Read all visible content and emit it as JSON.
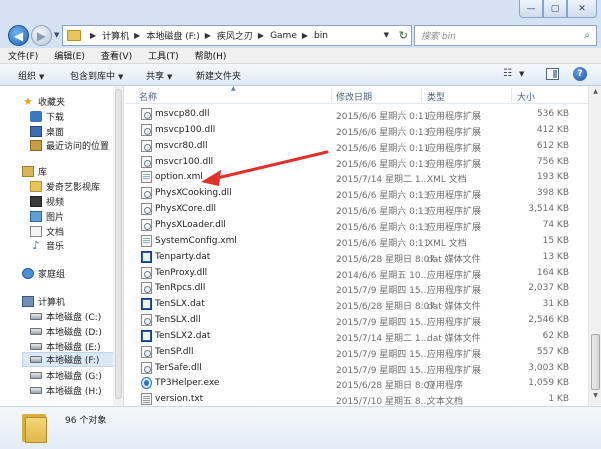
{
  "window": {
    "controls": [
      "—",
      "▢",
      "✕"
    ]
  },
  "nav": {
    "back_glyph": "◀",
    "forward_glyph": "▶",
    "dropdown_glyph": "▼"
  },
  "address": {
    "crumbs": [
      "计算机",
      "本地磁盘 (F:)",
      "疾风之刃",
      "Game",
      "bin"
    ],
    "separator": "▶",
    "dropdown_glyph": "▼",
    "refresh_glyph": "↻"
  },
  "search": {
    "placeholder": "搜索 bin",
    "icon": "search-icon"
  },
  "menu": [
    "文件(F)",
    "编辑(E)",
    "查看(V)",
    "工具(T)",
    "帮助(H)"
  ],
  "toolbar": {
    "organize": "组织",
    "include_in_library": "包含到库中",
    "share": "共享",
    "new_folder": "新建文件夹",
    "arrow": "▼",
    "view_glyph": "☷",
    "help_glyph": "?"
  },
  "sidebar": {
    "expander": "▲",
    "favorites": {
      "label": "收藏夹",
      "items": [
        "下载",
        "桌面",
        "最近访问的位置"
      ]
    },
    "library": {
      "label": "库",
      "items": [
        "爱奇艺影视库",
        "视频",
        "图片",
        "文档",
        "音乐"
      ]
    },
    "homegroup": {
      "label": "家庭组"
    },
    "computer": {
      "label": "计算机",
      "drives": [
        "本地磁盘 (C:)",
        "本地磁盘 (D:)",
        "本地磁盘 (E:)",
        "本地磁盘 (F:)",
        "本地磁盘 (G:)",
        "本地磁盘 (H:)"
      ],
      "selected_index": 3
    }
  },
  "columns": {
    "name": "名称",
    "modified": "修改日期",
    "type": "类型",
    "size": "大小",
    "sort_glyph": "▲"
  },
  "files": [
    {
      "name": "msvcp80.dll",
      "date": "2015/6/6 星期六 0:11",
      "type": "应用程序扩展",
      "size": "536 KB",
      "kind": "dll"
    },
    {
      "name": "msvcp100.dll",
      "date": "2015/6/6 星期六 0:13",
      "type": "应用程序扩展",
      "size": "412 KB",
      "kind": "dll"
    },
    {
      "name": "msvcr80.dll",
      "date": "2015/6/6 星期六 0:11",
      "type": "应用程序扩展",
      "size": "612 KB",
      "kind": "dll"
    },
    {
      "name": "msvcr100.dll",
      "date": "2015/6/6 星期六 0:13",
      "type": "应用程序扩展",
      "size": "756 KB",
      "kind": "dll"
    },
    {
      "name": "option.xml",
      "date": "2015/7/14 星期二 1...",
      "type": "XML 文档",
      "size": "193 KB",
      "kind": "xml"
    },
    {
      "name": "PhysXCooking.dll",
      "date": "2015/6/6 星期六 0:13",
      "type": "应用程序扩展",
      "size": "398 KB",
      "kind": "dll"
    },
    {
      "name": "PhysXCore.dll",
      "date": "2015/6/6 星期六 0:13",
      "type": "应用程序扩展",
      "size": "3,514 KB",
      "kind": "dll"
    },
    {
      "name": "PhysXLoader.dll",
      "date": "2015/6/6 星期六 0:13",
      "type": "应用程序扩展",
      "size": "74 KB",
      "kind": "dll"
    },
    {
      "name": "SystemConfig.xml",
      "date": "2015/6/6 星期六 0:11",
      "type": "XML 文档",
      "size": "15 KB",
      "kind": "xml"
    },
    {
      "name": "Tenparty.dat",
      "date": "2015/6/28 星期日 8:07",
      "type": "dat 媒体文件",
      "size": "13 KB",
      "kind": "dat"
    },
    {
      "name": "TenProxy.dll",
      "date": "2014/6/6 星期五 10...",
      "type": "应用程序扩展",
      "size": "164 KB",
      "kind": "dll"
    },
    {
      "name": "TenRpcs.dll",
      "date": "2015/7/9 星期四 15...",
      "type": "应用程序扩展",
      "size": "2,037 KB",
      "kind": "dll"
    },
    {
      "name": "TenSLX.dat",
      "date": "2015/6/28 星期日 8:07",
      "type": "dat 媒体文件",
      "size": "31 KB",
      "kind": "dat"
    },
    {
      "name": "TenSLX.dll",
      "date": "2015/7/9 星期四 15...",
      "type": "应用程序扩展",
      "size": "2,546 KB",
      "kind": "dll"
    },
    {
      "name": "TenSLX2.dat",
      "date": "2015/7/14 星期二 1...",
      "type": "dat 媒体文件",
      "size": "62 KB",
      "kind": "dat"
    },
    {
      "name": "TenSP.dll",
      "date": "2015/7/9 星期四 15...",
      "type": "应用程序扩展",
      "size": "557 KB",
      "kind": "dll"
    },
    {
      "name": "TerSafe.dll",
      "date": "2015/7/9 星期四 15...",
      "type": "应用程序扩展",
      "size": "3,003 KB",
      "kind": "dll"
    },
    {
      "name": "TP3Helper.exe",
      "date": "2015/6/28 星期日 8:07",
      "type": "应用程序",
      "size": "1,059 KB",
      "kind": "exe"
    },
    {
      "name": "version.txt",
      "date": "2015/7/10 星期五 8...",
      "type": "文本文档",
      "size": "1 KB",
      "kind": "txt"
    }
  ],
  "scrollbar": {
    "up_glyph": "▲",
    "down_glyph": "▼"
  },
  "annotation": {
    "color": "#e0302a"
  },
  "details": {
    "count": "96 个对象"
  }
}
